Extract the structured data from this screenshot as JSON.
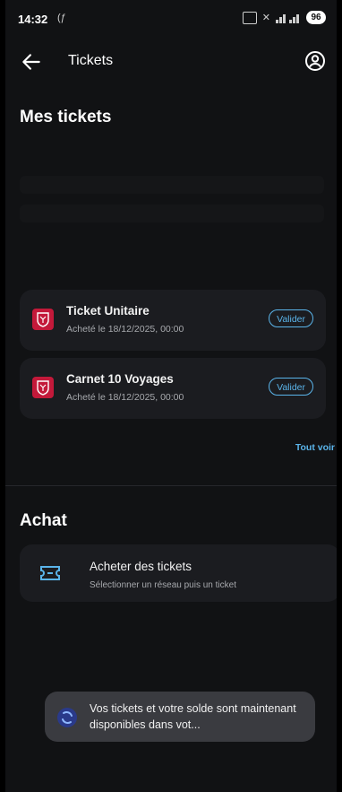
{
  "status_bar": {
    "time": "14:32",
    "small_icon": "(ƒ",
    "battery": "96"
  },
  "app_bar": {
    "title": "Tickets"
  },
  "tickets_section": {
    "title": "Mes tickets",
    "items": [
      {
        "name": "Ticket Unitaire",
        "purchased": "Acheté le 18/12/2025, 00:00",
        "action": "Valider"
      },
      {
        "name": "Carnet 10 Voyages",
        "purchased": "Acheté le 18/12/2025, 00:00",
        "action": "Valider"
      }
    ],
    "see_all": "Tout voir"
  },
  "purchase_section": {
    "title": "Achat",
    "item": {
      "title": "Acheter des tickets",
      "subtitle": "Sélectionner un réseau puis un ticket"
    }
  },
  "snackbar": {
    "message": "Vos tickets et votre solde sont maintenant disponibles dans vot..."
  },
  "colors": {
    "accent": "#5ab4ea",
    "ticket_icon": "#c3193a",
    "background": "#111214",
    "card": "#1b1c20"
  },
  "icons": {
    "back": "arrow-left-icon",
    "profile": "account-circle-icon",
    "ticket": "ticket-emblem-icon",
    "buy": "ticket-outline-icon",
    "snackbar": "app-logo-icon"
  }
}
